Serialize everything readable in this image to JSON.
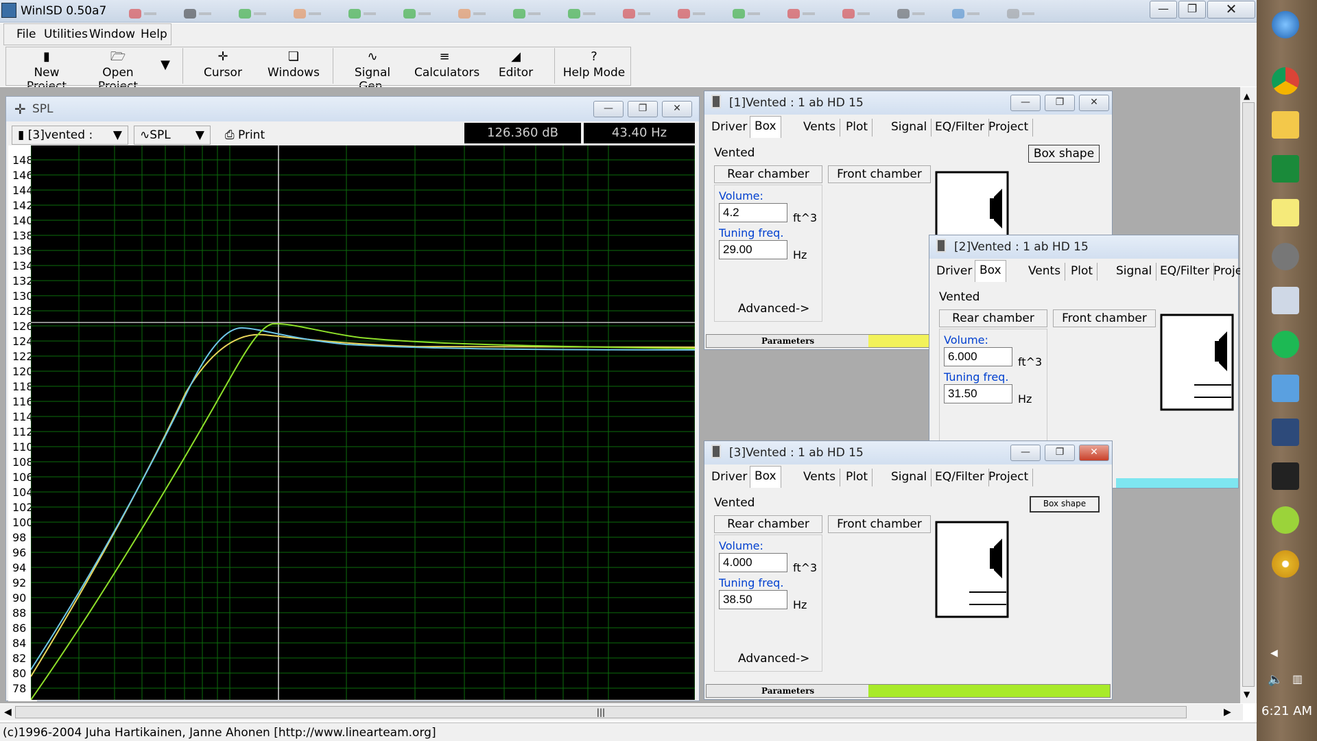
{
  "app": {
    "title": "WinISD 0.50a7"
  },
  "menu": [
    "File",
    "Utilities",
    "Window",
    "Help"
  ],
  "toolbar": {
    "new_project": "New Project",
    "open_project": "Open Project",
    "cursor": "Cursor",
    "windows": "Windows",
    "signal_gen": "Signal Gen.",
    "calculators": "Calculators",
    "editor": "Editor",
    "help_mode": "Help Mode"
  },
  "spl": {
    "title": "SPL",
    "project_select": "[3]vented :",
    "graph_select": "SPL",
    "print": "Print",
    "readout_db": "126.360 dB",
    "readout_hz": "43.40 Hz",
    "yticks": [
      "148",
      "146",
      "144",
      "142",
      "140",
      "138",
      "136",
      "134",
      "132",
      "130",
      "128",
      "126",
      "124",
      "122",
      "120",
      "118",
      "116",
      "114",
      "112",
      "110",
      "108",
      "106",
      "104",
      "102",
      "100",
      "98",
      "96",
      "94",
      "92",
      "90",
      "88",
      "86",
      "84",
      "82",
      "80",
      "78"
    ]
  },
  "drivers": [
    {
      "title": "[1]Vented : 1 ab HD 15",
      "tabs": [
        "Driver",
        "Box",
        "Vents",
        "Plot",
        "Signal",
        "EQ/Filter",
        "Project"
      ],
      "box_type": "Vented",
      "box_shape": "Box shape",
      "rear": "Rear chamber",
      "front": "Front chamber",
      "volume_label": "Volume:",
      "volume": "4.2",
      "volume_unit": "ft^3",
      "tuning_label": "Tuning freq.",
      "tuning": "29.00",
      "tuning_unit": "Hz",
      "advanced": "Advanced->",
      "params": "Parameters",
      "params_color": "#f2f25a"
    },
    {
      "title": "[2]Vented : 1 ab HD 15",
      "tabs": [
        "Driver",
        "Box",
        "Vents",
        "Plot",
        "Signal",
        "EQ/Filter",
        "Proje"
      ],
      "box_type": "Vented",
      "rear": "Rear chamber",
      "front": "Front chamber",
      "volume_label": "Volume:",
      "volume": "6.000",
      "volume_unit": "ft^3",
      "tuning_label": "Tuning freq.",
      "tuning": "31.50",
      "tuning_unit": "Hz",
      "params_color": "#7ee6f0"
    },
    {
      "title": "[3]Vented : 1 ab HD 15",
      "tabs": [
        "Driver",
        "Box",
        "Vents",
        "Plot",
        "Signal",
        "EQ/Filter",
        "Project"
      ],
      "box_type": "Vented",
      "box_shape": "Box shape",
      "rear": "Rear chamber",
      "front": "Front chamber",
      "volume_label": "Volume:",
      "volume": "4.000",
      "volume_unit": "ft^3",
      "tuning_label": "Tuning freq.",
      "tuning": "38.50",
      "tuning_unit": "Hz",
      "advanced": "Advanced->",
      "params": "Parameters",
      "params_color": "#a8ea2a"
    }
  ],
  "status": "(c)1996-2004 Juha Hartikainen, Janne Ahonen [http://www.linearteam.org]",
  "clock": "6:21 AM",
  "taskbar_icons": [
    "windows-orb-icon",
    "chrome-icon",
    "file-explorer-icon",
    "app-green-icon",
    "sticky-notes-icon",
    "mouse-icon",
    "calculator-icon",
    "spotify-icon",
    "control-panel-icon",
    "winisd-icon",
    "audio-wave-icon",
    "app-green-ring-icon",
    "dvd-icon"
  ]
}
